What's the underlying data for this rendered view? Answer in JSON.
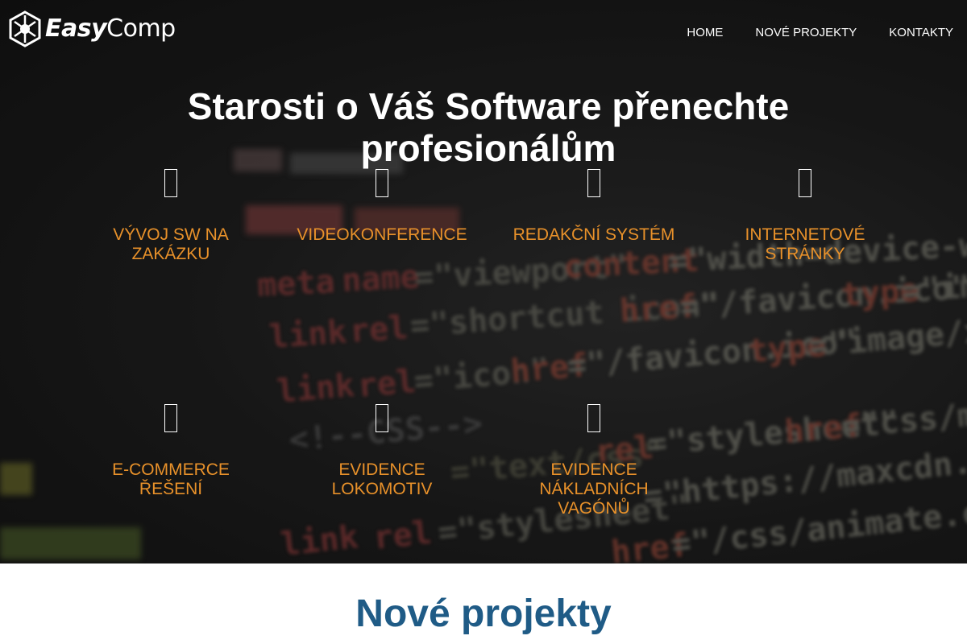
{
  "brand": {
    "logo_bold": "Easy",
    "logo_light": "Comp"
  },
  "nav": {
    "items": [
      "HOME",
      "NOVÉ PROJEKTY",
      "KONTAKTY"
    ]
  },
  "hero": {
    "headline": "Starosti o Váš Software přenechte profesionálům"
  },
  "services": [
    {
      "label": "VÝVOJ SW NA ZAKÁZKU",
      "icon": "code-icon"
    },
    {
      "label": "VIDEOKONFERENCE",
      "icon": "video-icon"
    },
    {
      "label": "REDAKČNÍ SYSTÉM",
      "icon": "edit-icon"
    },
    {
      "label": "INTERNETOVÉ STRÁNKY",
      "icon": "globe-icon"
    },
    {
      "label": "E-COMMERCE ŘEŠENÍ",
      "icon": "cart-icon"
    },
    {
      "label": "EVIDENCE LOKOMOTIV",
      "icon": "train-icon"
    },
    {
      "label": "EVIDENCE NÁKLADNÍCH VAGÓNŮ",
      "icon": "wagon-icon"
    }
  ],
  "section": {
    "title": "Nové projekty"
  },
  "colors": {
    "accent": "#e8912a",
    "section_title": "#1f5b86",
    "hero_bg": "#1b1b1b"
  }
}
